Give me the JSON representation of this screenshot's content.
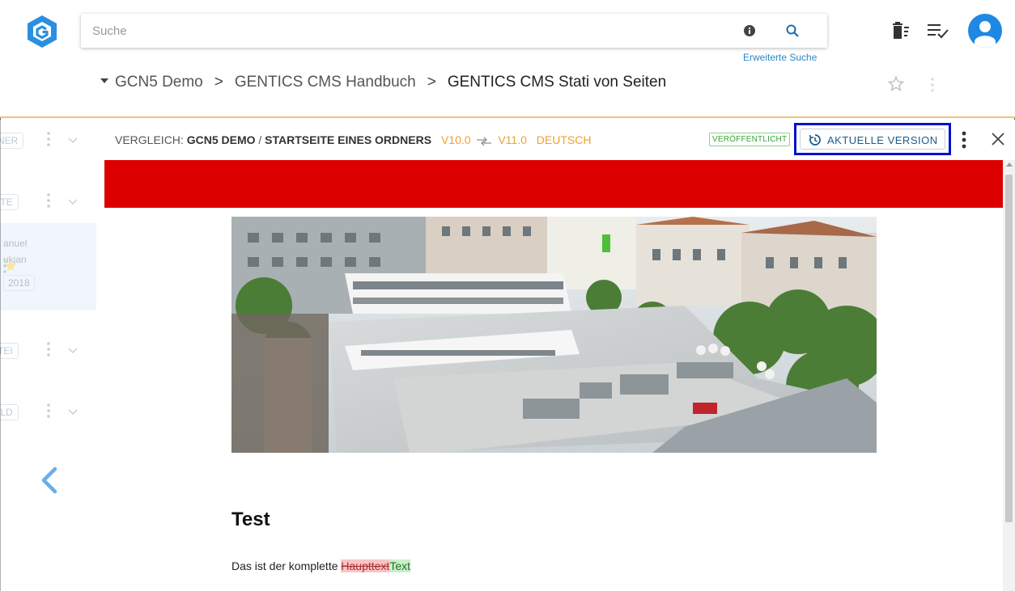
{
  "search": {
    "placeholder": "Suche",
    "advanced_label": "Erweiterte Suche"
  },
  "icons": {
    "logo": "gentics-logo",
    "info": "info-icon",
    "search": "search-icon",
    "trash": "trash-icon",
    "list": "list-check-icon",
    "avatar": "user-icon",
    "star": "star-icon",
    "history": "history-icon",
    "close": "close-icon",
    "back": "chevron-left-icon"
  },
  "breadcrumb": {
    "items": [
      "GCN5 Demo",
      "GENTICS CMS Handbuch",
      "GENTICS CMS Stati von Seiten"
    ],
    "separator": ">"
  },
  "left_panel": {
    "sections": [
      "NER",
      "ITE",
      "TEI",
      "ILD"
    ],
    "item_lines": [
      "anuel",
      "ukjan"
    ],
    "item_year": "2018"
  },
  "compare_bar": {
    "prefix": "VERGLEICH: ",
    "node": "GCN5 DEMO",
    "slash": " / ",
    "page": "STARTSEITE EINES ORDNERS",
    "version_from": "V10.0",
    "version_to": "V11.0",
    "language": "DEUTSCH",
    "status_badge": "VERÖFFENTLICHT",
    "current_version_label": "AKTUELLE VERSION"
  },
  "preview": {
    "title": "Test",
    "body_prefix": "Das ist der komplette ",
    "deleted_text": "Haupttext",
    "inserted_text": "Text"
  },
  "colors": {
    "brand_blue": "#1f88e5",
    "header_divider": "#f0c27a",
    "version_orange": "#f0a030",
    "published_green": "#3aa13a",
    "highlight_border": "#0010d0",
    "red_band": "#dd0000",
    "deleted_bg": "#f8c5c5",
    "inserted_bg": "#c9f0c9",
    "link": "#2b87c7"
  }
}
